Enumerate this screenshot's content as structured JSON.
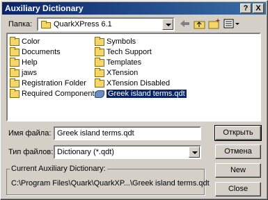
{
  "window": {
    "title": "Auxiliary Dictionary"
  },
  "titlebar": {
    "help_label": "?",
    "close_label": "X"
  },
  "lookin": {
    "label": "Папка:",
    "value": "QuarkXPress 6.1"
  },
  "toolbar": {
    "back_icon": "back-arrow-icon",
    "up_icon": "up-folder-icon",
    "newfolder_icon": "new-folder-icon",
    "view_icon": "view-menu-icon"
  },
  "files": [
    {
      "name": "Color",
      "type": "folder"
    },
    {
      "name": "Documents",
      "type": "folder"
    },
    {
      "name": "Help",
      "type": "folder"
    },
    {
      "name": "jaws",
      "type": "folder"
    },
    {
      "name": "Registration Folder",
      "type": "folder"
    },
    {
      "name": "Required Components",
      "type": "folder"
    },
    {
      "name": "Symbols",
      "type": "folder"
    },
    {
      "name": "Tech Support",
      "type": "folder"
    },
    {
      "name": "Templates",
      "type": "folder"
    },
    {
      "name": "XTension",
      "type": "folder"
    },
    {
      "name": "XTension Disabled",
      "type": "folder"
    },
    {
      "name": "Greek island terms.qdt",
      "type": "file",
      "selected": true
    }
  ],
  "filename": {
    "label": "Имя файла:",
    "value": "Greek island terms.qdt"
  },
  "filetype": {
    "label": "Тип файлов:",
    "value": "Dictionary (*.qdt)"
  },
  "buttons": {
    "open": "Открыть",
    "cancel": "Отмена",
    "new": "New",
    "close": "Close"
  },
  "current": {
    "label": "Current Auxiliary Dictionary:",
    "path": "C:\\Program Files\\Quark\\QuarkXP...\\Greek island terms.qdt"
  },
  "colors": {
    "title_bar": "#0a246a",
    "selection": "#0a246a",
    "face": "#d4d0c8"
  }
}
